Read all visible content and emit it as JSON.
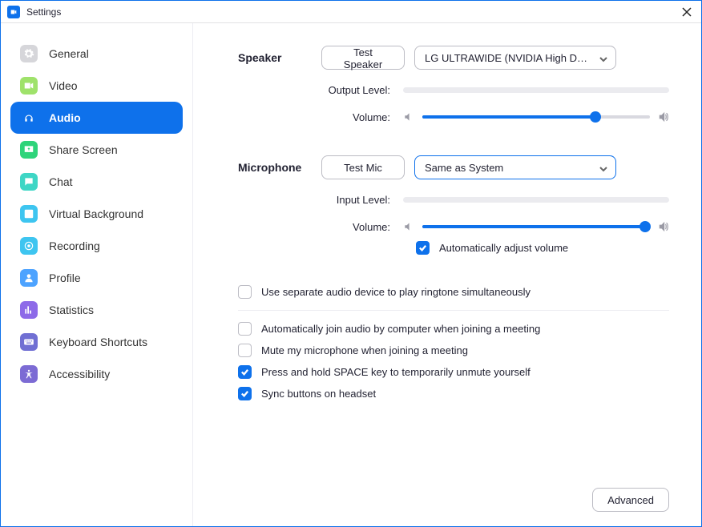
{
  "window": {
    "title": "Settings"
  },
  "sidebar": {
    "items": [
      {
        "label": "General",
        "icon": "gear-icon",
        "color": "#d6d6da"
      },
      {
        "label": "Video",
        "icon": "video-icon",
        "color": "#9fe26b"
      },
      {
        "label": "Audio",
        "icon": "headphones-icon",
        "color": "#0e71eb",
        "active": true
      },
      {
        "label": "Share Screen",
        "icon": "share-screen-icon",
        "color": "#2ed47a"
      },
      {
        "label": "Chat",
        "icon": "chat-icon",
        "color": "#3ed6c5"
      },
      {
        "label": "Virtual Background",
        "icon": "virtual-bg-icon",
        "color": "#3ec5f0"
      },
      {
        "label": "Recording",
        "icon": "recording-icon",
        "color": "#3ec5f0"
      },
      {
        "label": "Profile",
        "icon": "profile-icon",
        "color": "#4da3ff"
      },
      {
        "label": "Statistics",
        "icon": "statistics-icon",
        "color": "#8d6ae8"
      },
      {
        "label": "Keyboard Shortcuts",
        "icon": "keyboard-icon",
        "color": "#706fd3"
      },
      {
        "label": "Accessibility",
        "icon": "accessibility-icon",
        "color": "#7c6bd4"
      }
    ]
  },
  "audio": {
    "speaker": {
      "heading": "Speaker",
      "test_label": "Test Speaker",
      "device": "LG ULTRAWIDE (NVIDIA High Defi...",
      "output_level_label": "Output Level:",
      "volume_label": "Volume:",
      "volume_pct": 76
    },
    "microphone": {
      "heading": "Microphone",
      "test_label": "Test Mic",
      "device": "Same as System",
      "input_level_label": "Input Level:",
      "volume_label": "Volume:",
      "volume_pct": 98,
      "auto_adjust_label": "Automatically adjust volume",
      "auto_adjust_checked": true
    },
    "ringtone": {
      "label": "Use separate audio device to play ringtone simultaneously",
      "checked": false
    },
    "options": [
      {
        "label": "Automatically join audio by computer when joining a meeting",
        "checked": false
      },
      {
        "label": "Mute my microphone when joining a meeting",
        "checked": false
      },
      {
        "label": "Press and hold SPACE key to temporarily unmute yourself",
        "checked": true
      },
      {
        "label": "Sync buttons on headset",
        "checked": true
      }
    ],
    "advanced_label": "Advanced"
  }
}
